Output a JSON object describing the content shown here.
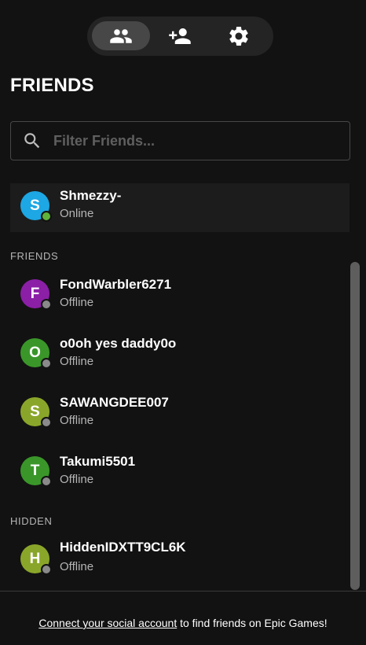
{
  "tabs": [
    {
      "icon": "friends-icon",
      "active": true
    },
    {
      "icon": "add-friend-icon",
      "active": false
    },
    {
      "icon": "gear-icon",
      "active": false
    }
  ],
  "page_title": "FRIENDS",
  "search": {
    "placeholder": "Filter Friends...",
    "value": ""
  },
  "online": [
    {
      "initial": "S",
      "name": "Shmezzy-",
      "status": "Online",
      "avatar_color": "#1da7e4",
      "dot_color": "#5fb33a"
    }
  ],
  "sections": {
    "friends": "FRIENDS",
    "hidden": "HIDDEN"
  },
  "friends": [
    {
      "initial": "F",
      "name": "FondWarbler6271",
      "status": "Offline",
      "avatar_color": "#8b1fa6",
      "dot_color": "#8a8a8a"
    },
    {
      "initial": "O",
      "name": "o0oh yes daddy0o",
      "status": "Offline",
      "avatar_color": "#3a9629",
      "dot_color": "#8a8a8a"
    },
    {
      "initial": "S",
      "name": "SAWANGDEE007",
      "status": "Offline",
      "avatar_color": "#8aa62a",
      "dot_color": "#8a8a8a"
    },
    {
      "initial": "T",
      "name": "Takumi5501",
      "status": "Offline",
      "avatar_color": "#3a9629",
      "dot_color": "#8a8a8a"
    }
  ],
  "hidden": [
    {
      "initial": "H",
      "name": "HiddenIDXTT9CL6K",
      "status": "Offline",
      "avatar_color": "#8aa62a",
      "dot_color": "#8a8a8a"
    }
  ],
  "footer": {
    "link": "Connect your social account",
    "text": " to find friends on Epic Games!"
  }
}
